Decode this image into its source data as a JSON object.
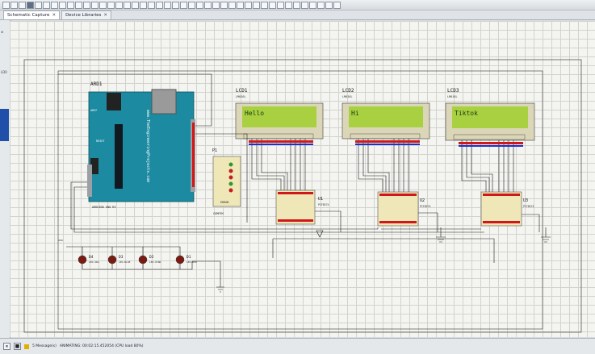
{
  "tabs": [
    {
      "label": "Schematic Capture",
      "active": true
    },
    {
      "label": "Device Libraries",
      "active": false
    }
  ],
  "sidebar": {
    "top_label": "⊕",
    "side_label": "LD0"
  },
  "schematic": {
    "arduino": {
      "ref": "ARD1",
      "brand": "www.TheEngineeringProjects.com",
      "footer": "ARDUINO UNO R3",
      "reset_label": "RESET",
      "aref_label": "AREF"
    },
    "lcds": [
      {
        "ref": "LCD1",
        "part": "LM016L",
        "text": "Hello"
      },
      {
        "ref": "LCD2",
        "part": "LM016L",
        "text": "Hi"
      },
      {
        "ref": "LCD3",
        "part": "LM016L",
        "text": "Tiktok"
      }
    ],
    "ics": [
      {
        "ref": "U1",
        "part": "PCF8574"
      },
      {
        "ref": "U2",
        "part": "PCF8574"
      },
      {
        "ref": "U3",
        "part": "PCF8574"
      }
    ],
    "connector": {
      "ref": "P1",
      "part": "COMPIM",
      "footer": "ERROR"
    },
    "leds": [
      {
        "ref": "D4",
        "part": "LED-ORG"
      },
      {
        "ref": "D3",
        "part": "LED-BLUE"
      },
      {
        "ref": "D2",
        "part": "LED-PINK"
      },
      {
        "ref": "D1",
        "part": "LED-RED"
      }
    ]
  },
  "status": {
    "messages": "5 Message(s)",
    "animating": "ANIMATING: 00:02:15.452054 (CPU load 80%)"
  },
  "colors": {
    "arduino_board": "#1c8aa0",
    "lcd_screen": "#a8d040",
    "wire": "#1a1a1a",
    "pin_red": "#d01818",
    "pin_blue": "#1830d0",
    "led": "#7a1a10",
    "sheet_border": "#555555"
  }
}
